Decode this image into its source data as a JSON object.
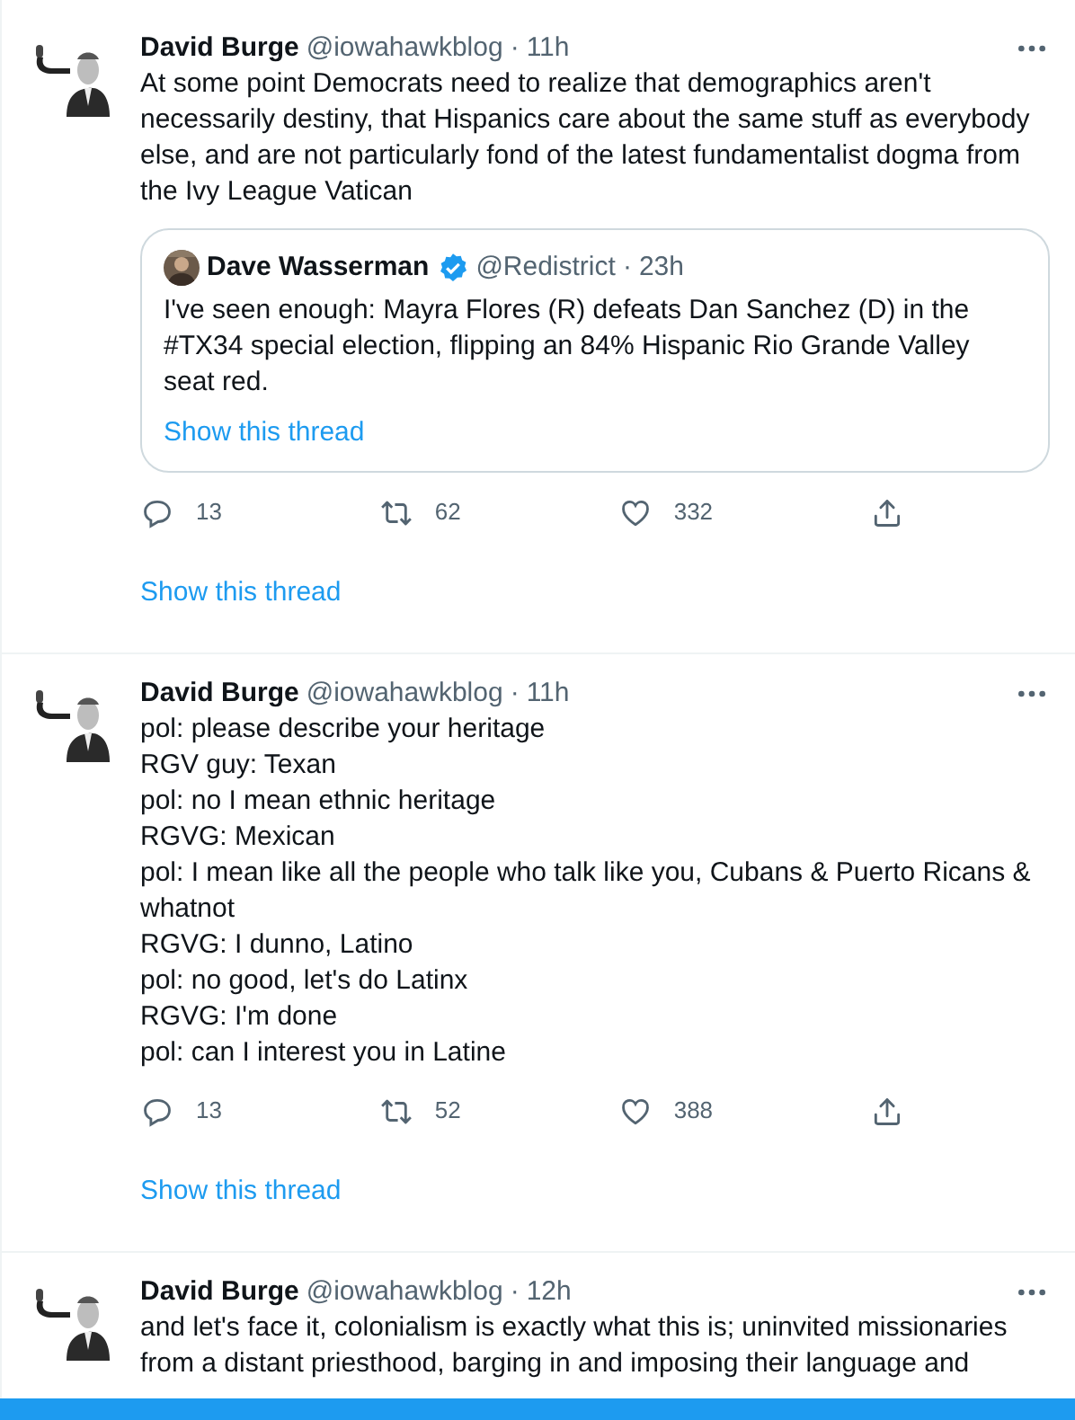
{
  "tweets": [
    {
      "author": "David Burge",
      "handle": "@iowahawkblog",
      "sep": "·",
      "time": "11h",
      "lines": [
        "At some point Democrats need to realize that demographics aren't necessarily destiny, that Hispanics care about the same stuff as everybody else, and are not particularly fond of the latest fundamentalist dogma from the Ivy League Vatican"
      ],
      "quote": {
        "author": "Dave Wasserman",
        "verified": true,
        "handle": "@Redistrict",
        "sep": "·",
        "time": "23h",
        "text": "I've seen enough: Mayra Flores (R) defeats Dan Sanchez (D) in the #TX34 special election, flipping an 84% Hispanic Rio Grande Valley seat red.",
        "link": "Show this thread"
      },
      "replies": "13",
      "retweets": "62",
      "likes": "332",
      "thread_link": "Show this thread"
    },
    {
      "author": "David Burge",
      "handle": "@iowahawkblog",
      "sep": "·",
      "time": "11h",
      "lines": [
        "pol: please describe your heritage",
        "RGV guy: Texan",
        "pol: no I mean ethnic heritage",
        "RGVG: Mexican",
        "pol: I mean like all the people who talk like you, Cubans & Puerto Ricans & whatnot",
        "RGVG: I dunno, Latino",
        "pol: no good, let's do Latinx",
        "RGVG: I'm done",
        "pol: can I interest you in Latine"
      ],
      "replies": "13",
      "retweets": "52",
      "likes": "388",
      "thread_link": "Show this thread"
    },
    {
      "author": "David Burge",
      "handle": "@iowahawkblog",
      "sep": "·",
      "time": "12h",
      "lines": [
        "and let's face it, colonialism is exactly what this is; uninvited missionaries",
        "from a distant priesthood, barging in and imposing their language and"
      ]
    }
  ]
}
